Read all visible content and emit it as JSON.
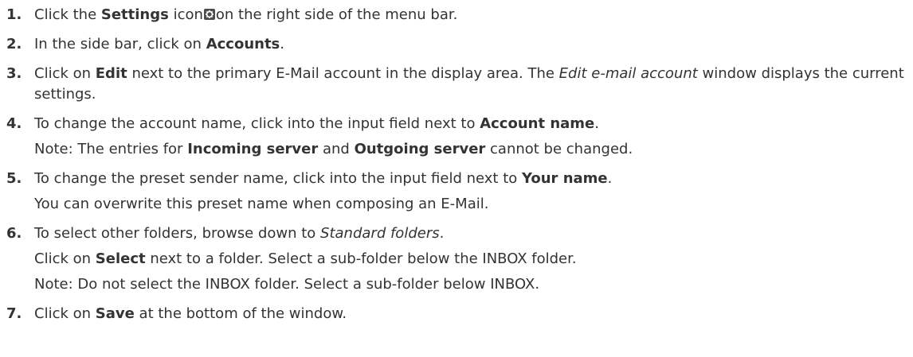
{
  "steps": [
    {
      "num": "1.",
      "lines": [
        [
          {
            "t": "Click the "
          },
          {
            "t": "Settings",
            "b": true
          },
          {
            "t": " icon"
          },
          {
            "icon": "settings-icon"
          },
          {
            "t": "on the right side of the menu bar."
          }
        ]
      ]
    },
    {
      "num": "2.",
      "lines": [
        [
          {
            "t": "In the side bar, click on "
          },
          {
            "t": "Accounts",
            "b": true
          },
          {
            "t": "."
          }
        ]
      ]
    },
    {
      "num": "3.",
      "lines": [
        [
          {
            "t": "Click on "
          },
          {
            "t": "Edit",
            "b": true
          },
          {
            "t": " next to the primary E-Mail account in the display area. The "
          },
          {
            "t": "Edit e-mail account",
            "i": true
          },
          {
            "t": " window displays the current settings."
          }
        ]
      ]
    },
    {
      "num": "4.",
      "lines": [
        [
          {
            "t": "To change the account name, click into the input field next to "
          },
          {
            "t": "Account name",
            "b": true
          },
          {
            "t": "."
          }
        ],
        [
          {
            "t": "Note: The entries for "
          },
          {
            "t": "Incoming server",
            "b": true
          },
          {
            "t": " and "
          },
          {
            "t": "Outgoing server",
            "b": true
          },
          {
            "t": " cannot be changed."
          }
        ]
      ]
    },
    {
      "num": "5.",
      "lines": [
        [
          {
            "t": "To change the preset sender name, click into the input field next to "
          },
          {
            "t": "Your name",
            "b": true
          },
          {
            "t": "."
          }
        ],
        [
          {
            "t": "You can overwrite this preset name when composing an E-Mail."
          }
        ]
      ]
    },
    {
      "num": "6.",
      "lines": [
        [
          {
            "t": "To select other folders, browse down to "
          },
          {
            "t": "Standard folders",
            "i": true
          },
          {
            "t": "."
          }
        ],
        [
          {
            "t": "Click on "
          },
          {
            "t": "Select",
            "b": true
          },
          {
            "t": " next to a folder. Select a sub-folder below the INBOX folder."
          }
        ],
        [
          {
            "t": "Note: Do not select the INBOX folder. Select a sub-folder below INBOX."
          }
        ]
      ]
    },
    {
      "num": "7.",
      "lines": [
        [
          {
            "t": "Click on "
          },
          {
            "t": "Save",
            "b": true
          },
          {
            "t": " at the bottom of the window."
          }
        ]
      ]
    }
  ]
}
